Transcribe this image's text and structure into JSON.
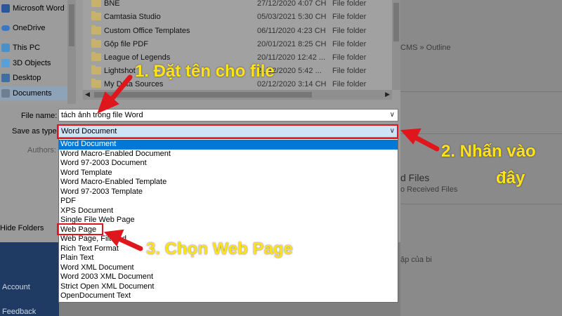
{
  "nav": {
    "items": [
      {
        "label": "Microsoft Word",
        "icon": "word-icon"
      },
      {
        "label": "OneDrive",
        "icon": "cloud-icon"
      },
      {
        "label": "This PC",
        "icon": "computer-icon"
      },
      {
        "label": "3D Objects",
        "icon": "cube-icon"
      },
      {
        "label": "Desktop",
        "icon": "desktop-icon"
      },
      {
        "label": "Documents",
        "icon": "documents-icon"
      }
    ]
  },
  "files": [
    {
      "name": "BNE",
      "date": "27/12/2020 4:07 CH",
      "type": "File folder"
    },
    {
      "name": "Camtasia Studio",
      "date": "05/03/2021 5:30 CH",
      "type": "File folder"
    },
    {
      "name": "Custom Office Templates",
      "date": "06/11/2020 4:23 CH",
      "type": "File folder"
    },
    {
      "name": "Gộp file PDF",
      "date": "20/01/2021 8:25 CH",
      "type": "File folder"
    },
    {
      "name": "League of Legends",
      "date": "20/11/2020 12:42 ...",
      "type": "File folder"
    },
    {
      "name": "Lightshot",
      "date": "21/12/2020 5:42 ...",
      "type": "File folder"
    },
    {
      "name": "My Data Sources",
      "date": "02/12/2020 3:14 CH",
      "type": "File folder"
    }
  ],
  "fields": {
    "file_name_label": "File name:",
    "file_name_value": "tách ảnh trong file Word",
    "save_type_label": "Save as type:",
    "save_type_value": "Word Document",
    "authors_label": "Authors:"
  },
  "hide_folders": "Hide Folders",
  "dropdown": {
    "options": [
      "Word Document",
      "Word Macro-Enabled Document",
      "Word 97-2003 Document",
      "Word Template",
      "Word Macro-Enabled Template",
      "Word 97-2003 Template",
      "PDF",
      "XPS Document",
      "Single File Web Page",
      "Web Page",
      "Web Page, Filtered",
      "Rich Text Format",
      "Plain Text",
      "Word XML Document",
      "Word 2003 XML Document",
      "Strict Open XML Document",
      "OpenDocument Text"
    ],
    "selected_index": 0
  },
  "backstage": {
    "left_items": [
      "Account",
      "Feedback"
    ],
    "breadcrumb": "CMS » Outline",
    "received_title": "d Files",
    "received_sub": "o Received Files",
    "note": "ập của bi"
  },
  "annotations": {
    "step1": "1. Đặt tên cho file",
    "step2_line1": "2. Nhấn vào",
    "step2_line2": "đây",
    "step3": "3. Chọn Web Page"
  },
  "colors": {
    "highlight_red": "#e0161d",
    "annotation_yellow": "#ffe21a",
    "selection_blue": "#0078d7"
  }
}
